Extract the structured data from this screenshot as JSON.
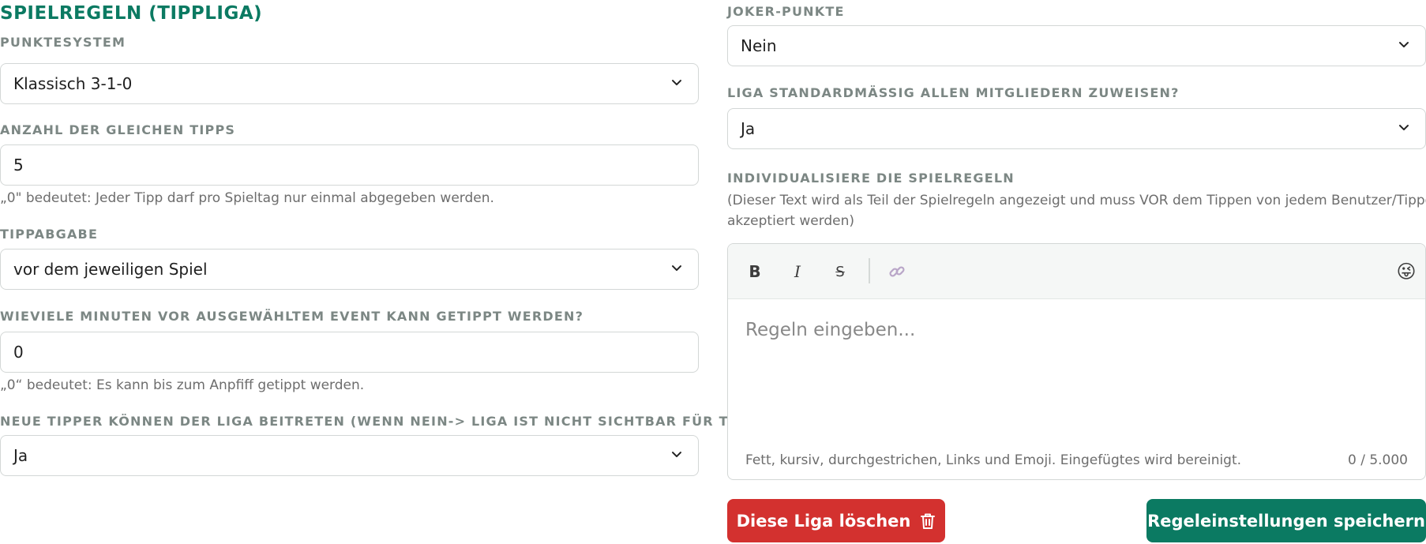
{
  "heading": "SPIELREGELN (TIPPLIGA)",
  "left": {
    "punktesystem": {
      "label": "PUNKTESYSTEM",
      "value": "Klassisch 3-1-0"
    },
    "gleiche_tipps": {
      "label": "ANZAHL DER GLEICHEN TIPPS",
      "value": "5",
      "hint": "„0\" bedeutet: Jeder Tipp darf pro Spieltag nur einmal abgegeben werden."
    },
    "tippabgabe": {
      "label": "TIPPABGABE",
      "value": "vor dem jeweiligen Spiel"
    },
    "minuten": {
      "label": "WIEVIELE MINUTEN VOR AUSGEWÄHLTEM EVENT KANN GETIPPT WERDEN?",
      "value": "0",
      "hint": "„0“ bedeutet: Es kann bis zum Anpfiff getippt werden."
    },
    "neue_tipper": {
      "label": "NEUE TIPPER KÖNNEN DER LIGA BEITRETEN (WENN NEIN-> LIGA IST NICHT SICHTBAR FÜR TIPPER)",
      "value": "Ja"
    }
  },
  "right": {
    "joker": {
      "label": "JOKER-PUNKTE",
      "value": "Nein"
    },
    "standard": {
      "label": "LIGA STANDARDMÄSSIG ALLEN MITGLIEDERN ZUWEISEN?",
      "value": "Ja"
    },
    "individual": {
      "label": "INDIVIDUALISIERE DIE SPIELREGELN",
      "description_line1": "(Dieser Text wird als Teil der Spielregeln angezeigt und muss VOR dem Tippen von jedem Benutzer/Tipper",
      "description_line2": "akzeptiert werden)"
    }
  },
  "editor": {
    "toolbar": {
      "bold": "B",
      "italic": "I",
      "strike": "S",
      "emoji": "😜"
    },
    "placeholder": "Regeln eingeben...",
    "help": "Fett, kursiv, durchgestrichen, Links und Emoji. Eingefügtes wird bereinigt.",
    "count": "0 / 5.000"
  },
  "buttons": {
    "delete": "Diese Liga löschen",
    "save": "Regeleinstellungen speichern"
  },
  "colors": {
    "accent": "#0b7a62",
    "danger": "#d3312f"
  },
  "icons": {
    "chevron": "chevron-down-icon",
    "link": "link-icon",
    "trash": "trash-icon",
    "emoji": "emoji-icon"
  }
}
